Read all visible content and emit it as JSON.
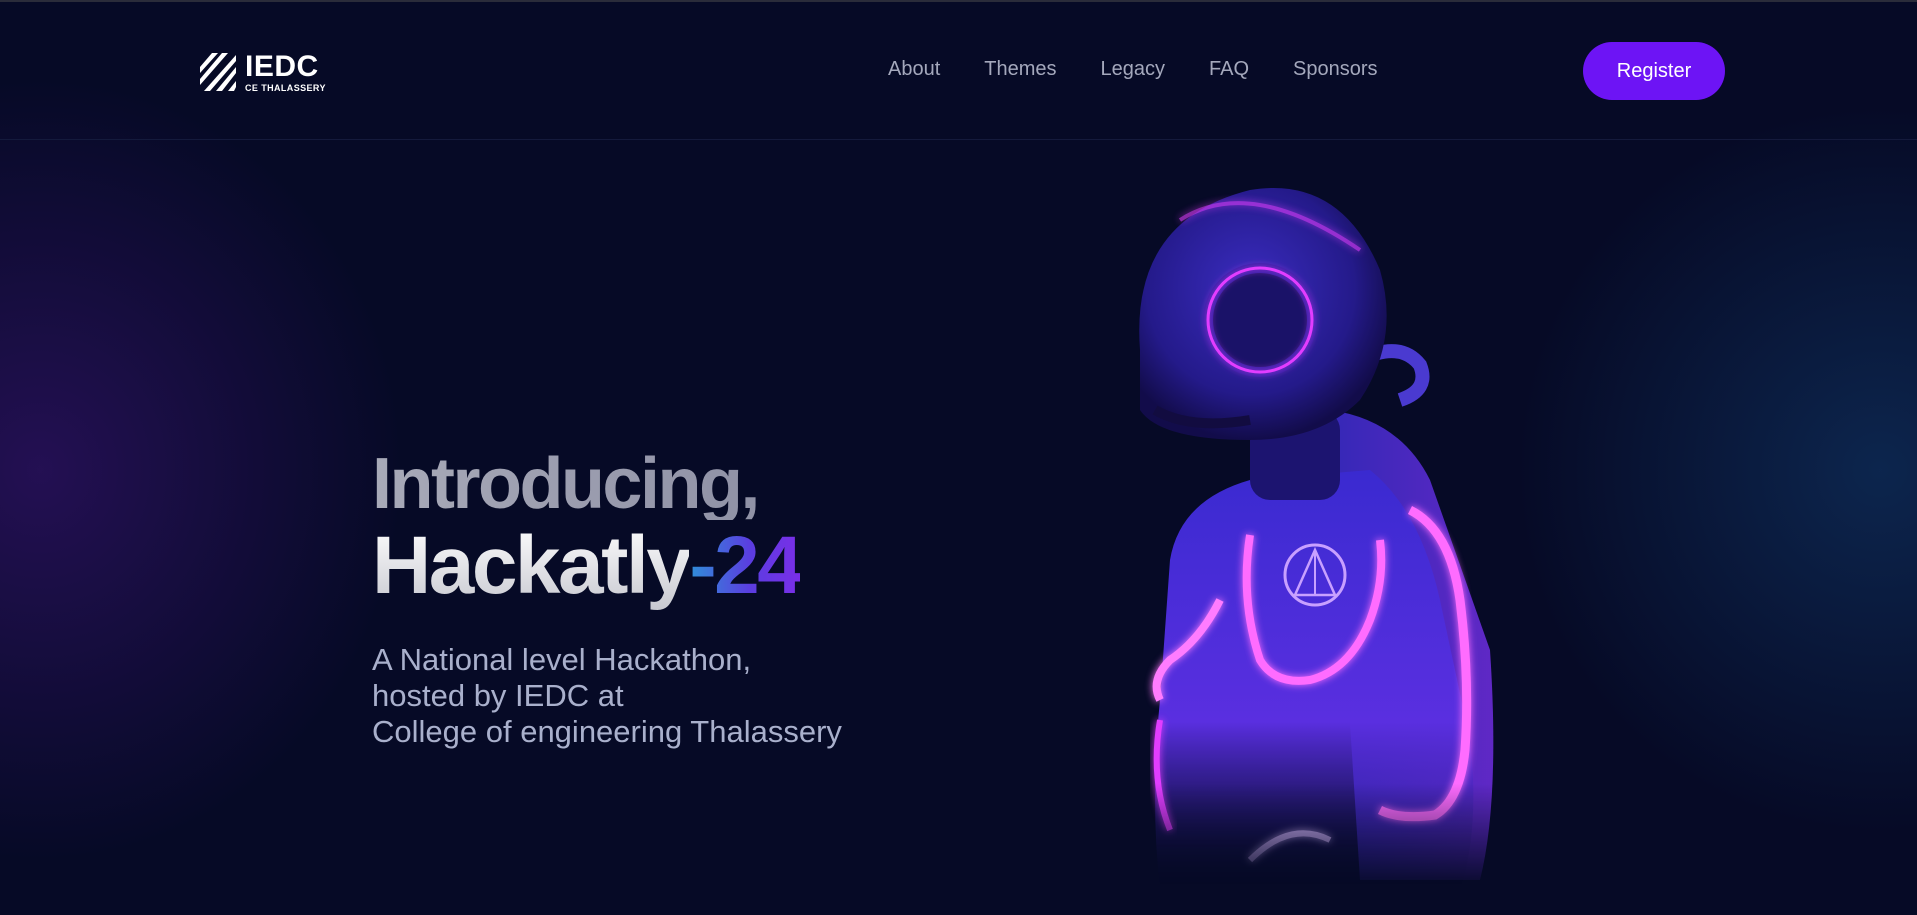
{
  "header": {
    "logo": {
      "icon": "iedc-stripes-logo",
      "title": "IEDC",
      "subtitle": "CE THALASSERY"
    },
    "nav": [
      {
        "label": "About"
      },
      {
        "label": "Themes"
      },
      {
        "label": "Legacy"
      },
      {
        "label": "FAQ"
      },
      {
        "label": "Sponsors"
      }
    ],
    "register_label": "Register"
  },
  "hero": {
    "intro": "Introducing,",
    "title_main": "Hackatly",
    "title_year": "-24",
    "subtitle_lines": [
      "A National level Hackathon,",
      "hosted by IEDC at",
      "College of engineering Thalassery"
    ],
    "illustration": "neon-astronaut-illustration"
  },
  "colors": {
    "background": "#060a26",
    "accent": "#6d14f5",
    "nav_text": "#a4a8bc",
    "subtitle_text": "#a9b0cc",
    "neon_pink": "#e23cff",
    "neon_purple": "#6a2df0"
  }
}
